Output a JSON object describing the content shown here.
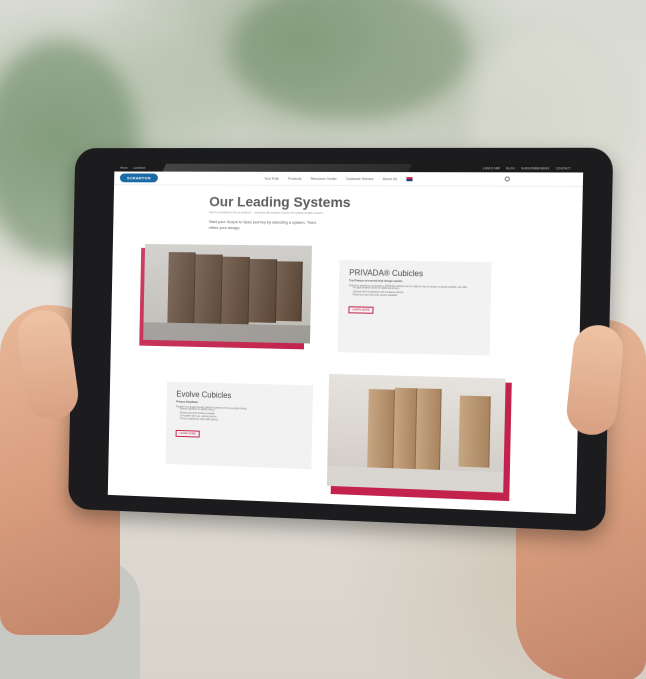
{
  "topbar": {
    "left_items": [
      "About",
      "Locations"
    ],
    "right_items": [
      "1.800.5.SBP",
      "BLOG",
      "SUBSCRIBE/NEWS",
      "CONTACT"
    ]
  },
  "navbar": {
    "logo_text": "SCRANTON",
    "items": [
      "Your Role",
      "Products",
      "Resource Center",
      "Customer Service",
      "About Us"
    ]
  },
  "page": {
    "title": "Our Leading Systems",
    "subtitle": "Start to manufacture the top partitions ... selecting with designer. Explore the leading durable systems.",
    "intro": "Start your Scope to Spec journey by selecting a system. Then, refine your design."
  },
  "cards": [
    {
      "title": "PRIVADA® Cubicles",
      "tag": "Top Privacy on a wood-look design system",
      "text": "With their seamless construction, PRIVADA cubicles are the highest form of privacy a design partition can offer.",
      "bullets": [
        "No gaps between doors for additional privacy.",
        "Optional flush-fit hardware with integrated options.",
        "Wood-look and solid color options available."
      ],
      "button": "LEARN MORE"
    },
    {
      "title": "Evolve Cubicles",
      "tag": "Privacy Simplified",
      "text": "Durable and design-friendly partition systems for the everyday facility.",
      "bullets": [
        "Narrow sightlines for added privacy.",
        "Design wood-look finishes available.",
        "Compatible with your existing options.",
        "Proven durability for high-traffic spaces."
      ],
      "button": "LEARN MORE"
    }
  ],
  "colors": {
    "accent": "#c2224b",
    "logo": "#1b6aa6"
  }
}
